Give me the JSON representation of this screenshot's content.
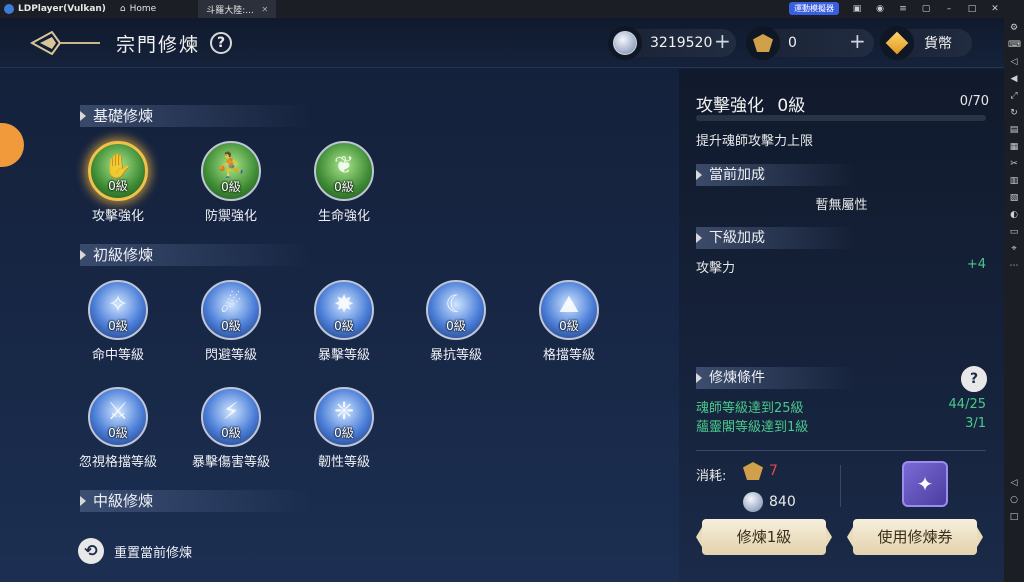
{
  "emulator": {
    "app_name": "LDPlayer(Vulkan)",
    "tabs": [
      {
        "label": "Home"
      },
      {
        "label": "斗羅大陸:..."
      }
    ],
    "ad_button": "運動模擬器"
  },
  "header": {
    "title": "宗門修煉",
    "help": "?",
    "currency_silver": "3219520",
    "currency_badge": "0",
    "currency_label": "貨幣"
  },
  "sections": {
    "basic": "基礎修煉",
    "beginner": "初級修煉",
    "intermediate": "中級修煉"
  },
  "skills_basic": [
    {
      "name": "攻擊強化",
      "level": "0級",
      "symbol": "✋"
    },
    {
      "name": "防禦強化",
      "level": "0級",
      "symbol": "⛹"
    },
    {
      "name": "生命強化",
      "level": "0級",
      "symbol": "❦"
    }
  ],
  "skills_beginner": [
    {
      "name": "命中等級",
      "level": "0級",
      "symbol": "✧"
    },
    {
      "name": "閃避等級",
      "level": "0級",
      "symbol": "☄"
    },
    {
      "name": "暴擊等級",
      "level": "0級",
      "symbol": "✸"
    },
    {
      "name": "暴抗等級",
      "level": "0級",
      "symbol": "☾"
    },
    {
      "name": "格擋等級",
      "level": "0級",
      "symbol": "⛰"
    },
    {
      "name": "忽視格擋等級",
      "level": "0級",
      "symbol": "⚔"
    },
    {
      "name": "暴擊傷害等級",
      "level": "0級",
      "symbol": "⚡"
    },
    {
      "name": "韌性等級",
      "level": "0級",
      "symbol": "❈"
    }
  ],
  "reset_label": "重置當前修煉",
  "detail": {
    "title": "攻擊強化",
    "level": "0級",
    "progress_text": "0/70",
    "progress_fraction": 0,
    "description": "提升魂師攻擊力上限",
    "current_bonus_header": "當前加成",
    "current_bonus_value": "暫無屬性",
    "next_bonus_header": "下級加成",
    "next_bonus_stat": "攻擊力",
    "next_bonus_value": "+4",
    "conditions_header": "修煉條件",
    "conditions": [
      {
        "label": "魂師等級達到25級",
        "value": "44/25"
      },
      {
        "label": "蘊靈閣等級達到1級",
        "value": "3/1"
      }
    ],
    "cost_label": "消耗:",
    "cost_badge": "7",
    "cost_silver": "840",
    "train_button": "修煉1級",
    "ticket_button": "使用修煉券"
  },
  "colors": {
    "accent_green": "#49c98c",
    "selected_glow": "#f2c14a",
    "cost_red": "#e34a4a"
  }
}
